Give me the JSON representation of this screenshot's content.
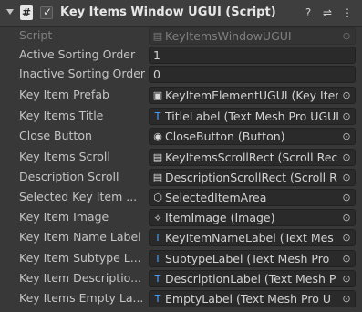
{
  "component": {
    "title": "Key Items Window UGUI (Script)",
    "script_icon_glyph": "#",
    "enabled_glyph": "✓",
    "help_icon": "?",
    "preset_icon": "⇌",
    "menu_icon": "⋮"
  },
  "fields": [
    {
      "label": "Script",
      "value": "KeyItemsWindowUGUI",
      "icon": "▤"
    },
    {
      "label": "Active Sorting Order",
      "value": "1"
    },
    {
      "label": "Inactive Sorting Order",
      "value": "0"
    },
    {
      "label": "Key Item Prefab",
      "value": "KeyItemElementUGUI (Key Item",
      "icon": "▣"
    },
    {
      "label": "Key Items Title",
      "value": "TitleLabel (Text Mesh Pro UGUI",
      "icon": "T"
    },
    {
      "label": "Close Button",
      "value": "CloseButton (Button)",
      "icon": "◉"
    },
    {
      "label": "Key Items Scroll",
      "value": "KeyItemsScrollRect (Scroll Rec",
      "icon": "▤"
    },
    {
      "label": "Description Scroll",
      "value": "DescriptionScrollRect (Scroll R",
      "icon": "▤"
    },
    {
      "label": "Selected Key Item ...",
      "value": "SelectedItemArea",
      "icon": "⬡"
    },
    {
      "label": "Key Item Image",
      "value": "ItemImage (Image)",
      "icon": "⟡"
    },
    {
      "label": "Key Item Name Label",
      "value": "KeyItemNameLabel (Text Mes",
      "icon": "T"
    },
    {
      "label": "Key Item Subtype L...",
      "value": "SubtypeLabel (Text Mesh Pro",
      "icon": "T"
    },
    {
      "label": "Key Item Descriptio...",
      "value": "DescriptionLabel (Text Mesh P",
      "icon": "T"
    },
    {
      "label": "Key Items Empty La...",
      "value": "EmptyLabel (Text Mesh Pro U",
      "icon": "T"
    }
  ],
  "picker_glyph": "⊙"
}
